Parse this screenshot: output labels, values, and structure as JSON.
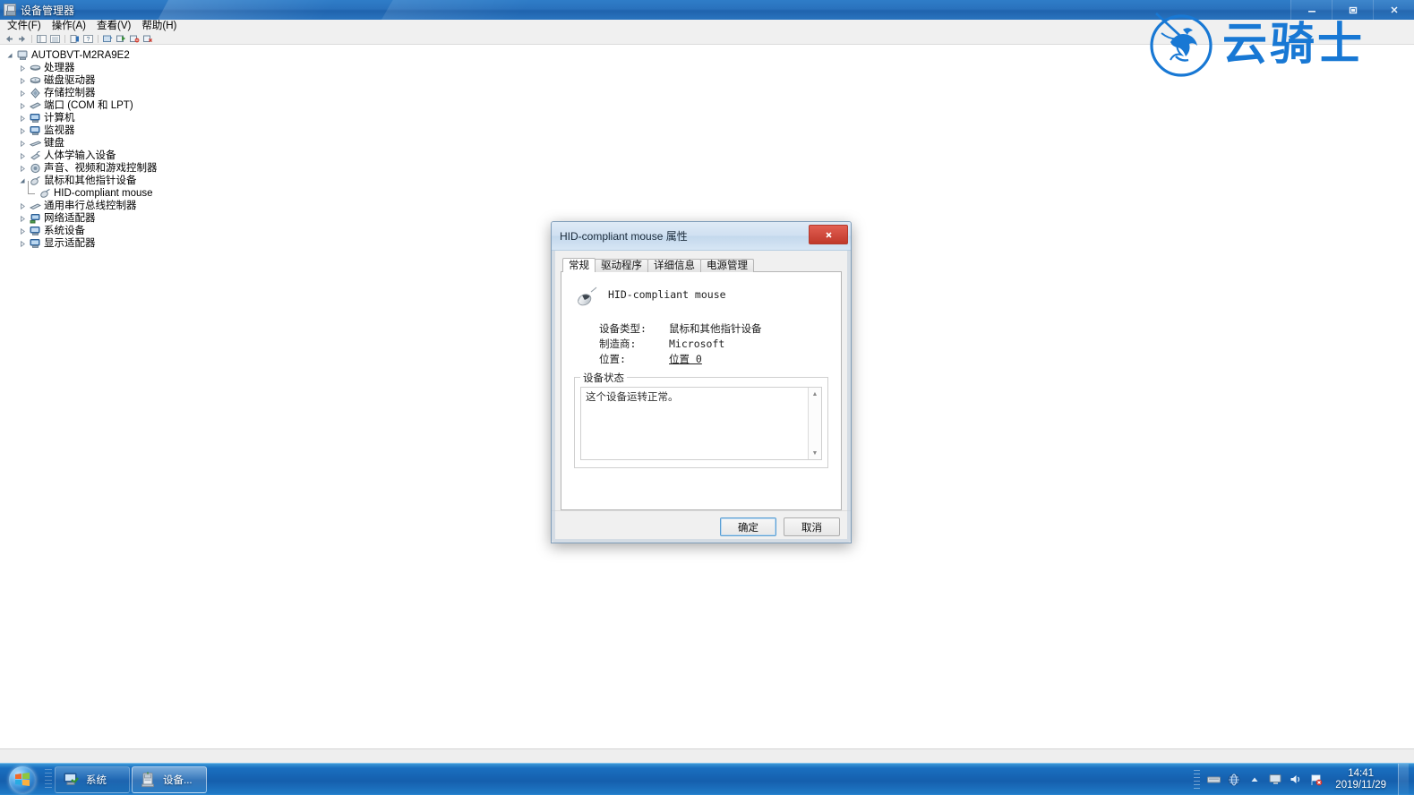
{
  "window": {
    "title": "设备管理器",
    "title_icon": "device-manager-icon",
    "controls": {
      "minimize": "–",
      "restore": "❐",
      "close": "✕"
    }
  },
  "menubar": [
    {
      "label": "文件(F)",
      "name": "menu-file"
    },
    {
      "label": "操作(A)",
      "name": "menu-action"
    },
    {
      "label": "查看(V)",
      "name": "menu-view"
    },
    {
      "label": "帮助(H)",
      "name": "menu-help"
    }
  ],
  "toolbar": [
    {
      "name": "back-icon"
    },
    {
      "name": "forward-icon"
    },
    {
      "name": "show-hide-tree-icon"
    },
    {
      "name": "properties-icon"
    },
    {
      "name": "help-icon"
    },
    {
      "name": "list-view-icon"
    },
    {
      "name": "update-driver-icon"
    },
    {
      "name": "scan-hardware-changes-icon"
    },
    {
      "name": "disable-device-icon"
    },
    {
      "name": "uninstall-device-icon"
    }
  ],
  "tree": {
    "root": {
      "label": "AUTOBVT-M2RA9E2",
      "icon": "computer-icon",
      "expanded": true
    },
    "items": [
      {
        "label": "处理器",
        "icon": "processor-icon",
        "expanded": false
      },
      {
        "label": "磁盘驱动器",
        "icon": "disk-drive-icon",
        "expanded": false
      },
      {
        "label": "存储控制器",
        "icon": "storage-controller-icon",
        "expanded": false
      },
      {
        "label": "端口 (COM 和 LPT)",
        "icon": "port-icon",
        "expanded": false
      },
      {
        "label": "计算机",
        "icon": "computer-icon",
        "expanded": false
      },
      {
        "label": "监视器",
        "icon": "monitor-icon",
        "expanded": false
      },
      {
        "label": "键盘",
        "icon": "keyboard-icon",
        "expanded": false
      },
      {
        "label": "人体学输入设备",
        "icon": "hid-icon",
        "expanded": false
      },
      {
        "label": "声音、视频和游戏控制器",
        "icon": "sound-icon",
        "expanded": false
      },
      {
        "label": "鼠标和其他指针设备",
        "icon": "mouse-icon",
        "expanded": true
      },
      {
        "label": "通用串行总线控制器",
        "icon": "usb-icon",
        "expanded": false
      },
      {
        "label": "网络适配器",
        "icon": "network-adapter-icon",
        "expanded": false
      },
      {
        "label": "系统设备",
        "icon": "system-device-icon",
        "expanded": false
      },
      {
        "label": "显示适配器",
        "icon": "display-adapter-icon",
        "expanded": false
      }
    ],
    "child": {
      "label": "HID-compliant mouse",
      "icon": "mouse-icon"
    }
  },
  "watermark": {
    "text": "云骑士",
    "color": "#1878d4",
    "emblem": "horse-rider-circle-logo"
  },
  "dialog": {
    "title": "HID-compliant mouse 属性",
    "close_label": "✕",
    "tabs": [
      {
        "label": "常规",
        "active": true
      },
      {
        "label": "驱动程序",
        "active": false
      },
      {
        "label": "详细信息",
        "active": false
      },
      {
        "label": "电源管理",
        "active": false
      }
    ],
    "device_name": "HID-compliant mouse",
    "device_icon": "mouse-icon",
    "properties": [
      {
        "key": "设备类型:",
        "value": "鼠标和其他指针设备",
        "link": false
      },
      {
        "key": "制造商:",
        "value": "Microsoft",
        "link": false
      },
      {
        "key": "位置:",
        "value": "位置 0",
        "link": true
      }
    ],
    "status_group_label": "设备状态",
    "status_text": "这个设备运转正常。",
    "scroll_up": "▲",
    "scroll_down": "▼",
    "buttons": {
      "ok": "确定",
      "cancel": "取消"
    }
  },
  "taskbar": {
    "start": "start-orb",
    "items": [
      {
        "label": "系统",
        "icon": "system-window-icon",
        "active": false
      },
      {
        "label": "设备...",
        "icon": "device-manager-icon",
        "active": true
      }
    ],
    "tray": [
      {
        "name": "hidden-icons-icon",
        "glyph": "▲"
      },
      {
        "name": "network-icon",
        "glyph": ""
      },
      {
        "name": "volume-icon",
        "glyph": ""
      },
      {
        "name": "action-center-flag-icon",
        "glyph": ""
      }
    ],
    "clock": {
      "time": "14:41",
      "date": "2019/11/29"
    }
  }
}
